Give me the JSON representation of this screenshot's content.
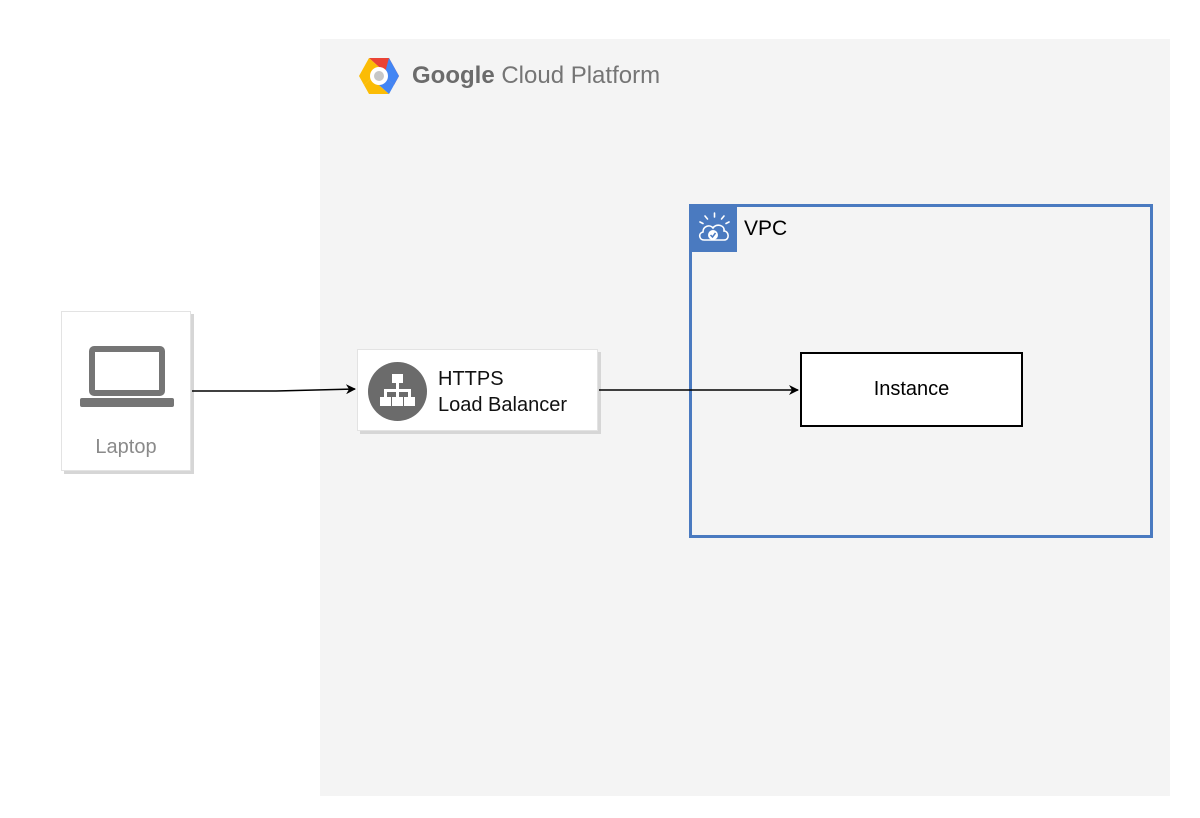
{
  "platform": {
    "brand": "Google",
    "product": "Cloud Platform"
  },
  "nodes": {
    "laptop": {
      "label": "Laptop",
      "icon": "laptop-icon"
    },
    "load_balancer": {
      "line1": "HTTPS",
      "line2": "Load Balancer",
      "icon": "load-balancer-icon"
    },
    "vpc": {
      "label": "VPC",
      "icon": "vpc-cloud-lock-icon"
    },
    "instance": {
      "label": "Instance"
    }
  },
  "colors": {
    "gcp_background": "#f4f4f4",
    "vpc_border": "#4a7ac0",
    "icon_gray": "#757575"
  }
}
